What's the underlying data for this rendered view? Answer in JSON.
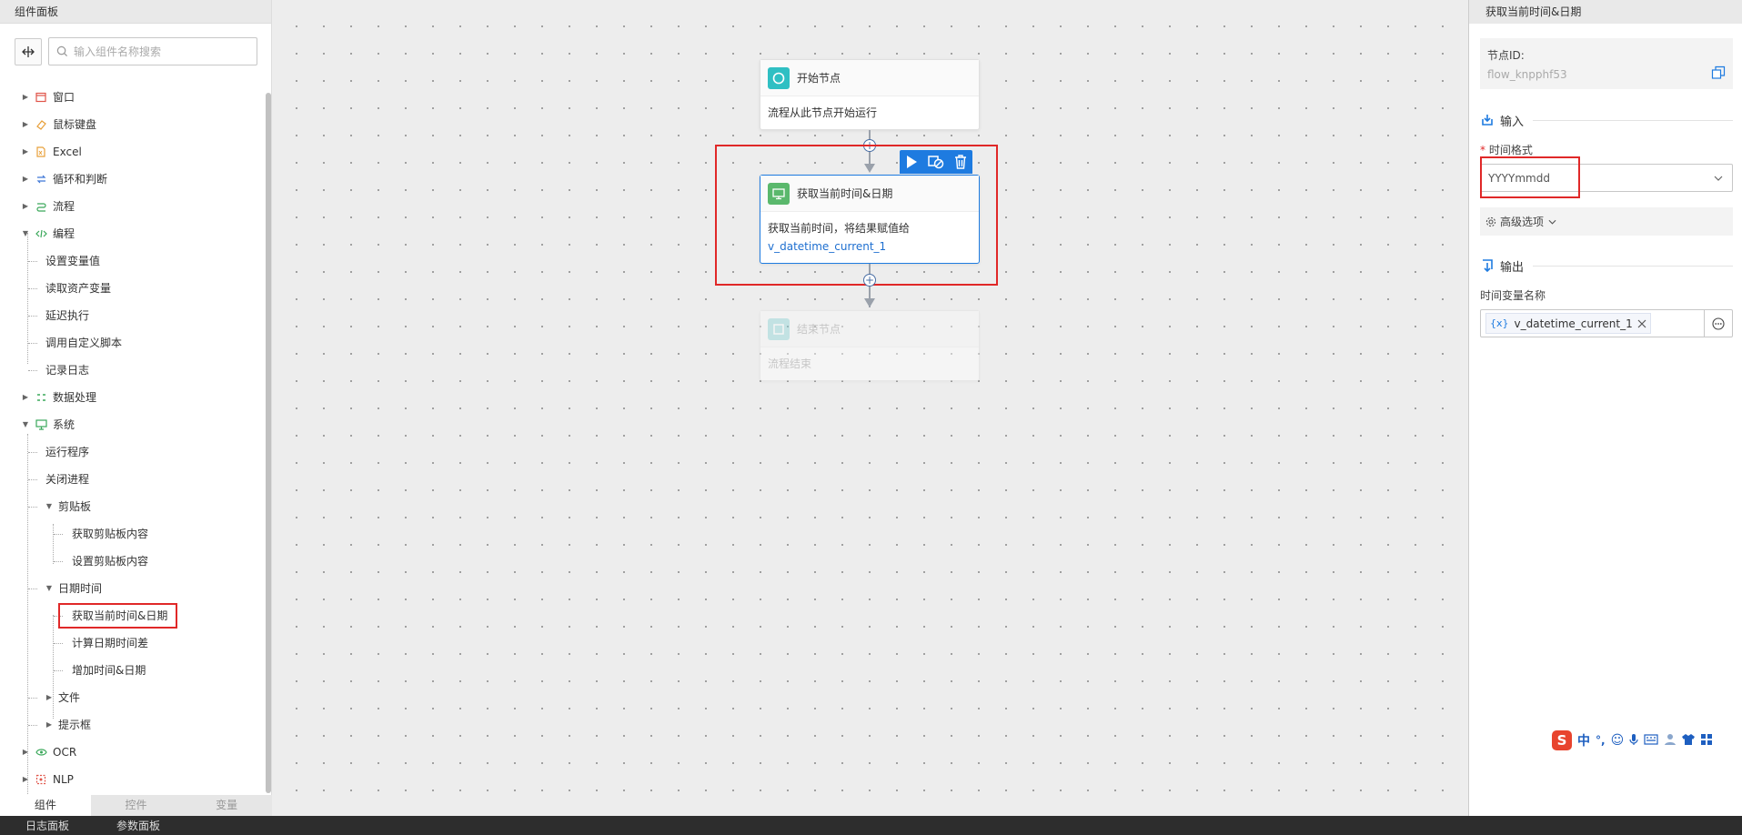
{
  "left_panel": {
    "title": "组件面板",
    "search_placeholder": "输入组件名称搜索",
    "tree": {
      "window": "窗口",
      "mouse_keyboard": "鼠标键盘",
      "excel": "Excel",
      "loop_condition": "循环和判断",
      "flow": "流程",
      "programming": "编程",
      "set_var": "设置变量值",
      "read_asset_var": "读取资产变量",
      "delay": "延迟执行",
      "call_script": "调用自定义脚本",
      "log": "记录日志",
      "data_processing": "数据处理",
      "system": "系统",
      "run_program": "运行程序",
      "close_process": "关闭进程",
      "clipboard": "剪贴板",
      "get_clipboard": "获取剪贴板内容",
      "set_clipboard": "设置剪贴板内容",
      "datetime": "日期时间",
      "get_datetime": "获取当前时间&日期",
      "calc_diff": "计算日期时间差",
      "add_datetime": "增加时间&日期",
      "file": "文件",
      "prompt": "提示框",
      "ocr": "OCR",
      "nlp": "NLP"
    },
    "tabs": [
      "组件",
      "控件",
      "变量"
    ]
  },
  "bottom_bar": {
    "log_panel": "日志面板",
    "param_panel": "参数面板"
  },
  "canvas": {
    "start_node": {
      "title": "开始节点",
      "desc": "流程从此节点开始运行"
    },
    "current_node": {
      "title": "获取当前时间&日期",
      "desc": "获取当前时间，将结果赋值给",
      "var": "v_datetime_current_1"
    },
    "end_node": {
      "title": "结束节点",
      "desc": "流程结束"
    }
  },
  "right_panel": {
    "title": "获取当前时间&日期",
    "node_id_label": "节点ID:",
    "node_id": "flow_knpphf53",
    "input_section": "输入",
    "required_mark": "*",
    "time_format_label": "时间格式",
    "time_format_value": "YYYYmmdd",
    "advanced": "高级选项",
    "output_section": "输出",
    "output_var_label": "时间变量名称",
    "var_prefix": "{x}",
    "output_var": "v_datetime_current_1"
  },
  "ime": {
    "lang": "中",
    "punct": "°,"
  },
  "colors": {
    "accent": "#1e7be0",
    "highlight": "#e02828",
    "link": "#1e6fd0"
  }
}
